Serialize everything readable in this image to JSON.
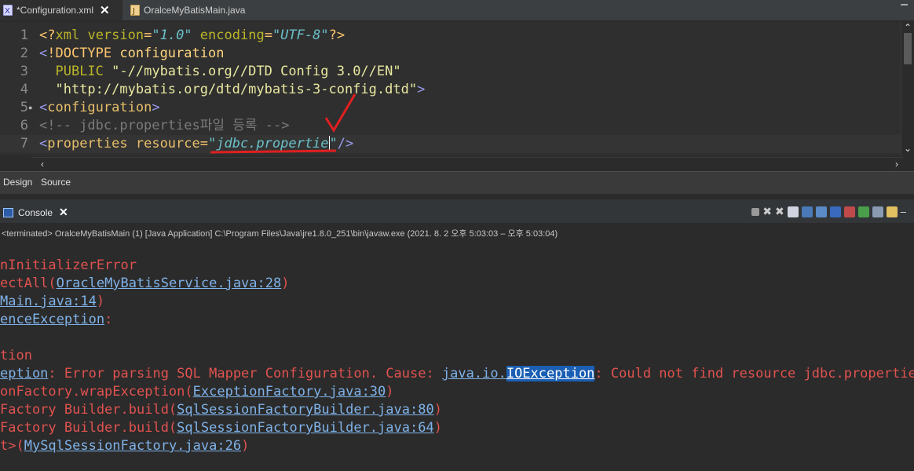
{
  "editor_tabs": [
    {
      "label": "*Configuration.xml",
      "icon": "xml-file-icon",
      "active": true
    },
    {
      "label": "OralceMyBatisMain.java",
      "icon": "java-file-icon",
      "active": false
    }
  ],
  "editor": {
    "lines": [
      {
        "n": "1",
        "text": "<?xml version=\"1.0\" encoding=\"UTF-8\"?>"
      },
      {
        "n": "2",
        "text": "<!DOCTYPE configuration"
      },
      {
        "n": "3",
        "text": "  PUBLIC \"-//mybatis.org//DTD Config 3.0//EN\""
      },
      {
        "n": "4",
        "text": "  \"http://mybatis.org/dtd/mybatis-3-config.dtd\">"
      },
      {
        "n": "5",
        "text": "<configuration>"
      },
      {
        "n": "6",
        "text": "<!-- jdbc.properties파일 등록 -->"
      },
      {
        "n": "7",
        "text": "<properties resource=\"jdbc.propertie\"/>"
      }
    ]
  },
  "bottom_tabs": {
    "design": "Design",
    "source": "Source"
  },
  "console": {
    "title": "Console",
    "terminated": "<terminated> OralceMyBatisMain (1) [Java Application] C:\\Program Files\\Java\\jre1.8.0_251\\bin\\javaw.exe  (2021. 8. 2 오후 5:03:03 – 오후 5:03:04)",
    "lines": [
      {
        "pre": "nInitializerError",
        "link": "",
        "post": ""
      },
      {
        "pre": "ectAll(",
        "link": "OracleMyBatisService.java:28",
        "post": ")"
      },
      {
        "pre": "",
        "link": "Main.java:14",
        "post": ")"
      },
      {
        "pre": "",
        "link": "enceException",
        "post": ":"
      },
      {
        "pre": "",
        "link": "",
        "post": ""
      },
      {
        "pre": "tion",
        "link": "",
        "post": ""
      },
      {
        "pre": "",
        "link": "eption",
        "post": ": Error parsing SQL Mapper Configuration. Cause: "
      },
      {
        "pre": "onFactory.wrapException(",
        "link": "ExceptionFactory.java:30",
        "post": ")"
      },
      {
        "pre": "Factory Builder.build(",
        "link": "SqlSessionFactoryBuilder.java:80",
        "post": ")"
      },
      {
        "pre": "Factory Builder.build(",
        "link": "SqlSessionFactoryBuilder.java:64",
        "post": ")"
      },
      {
        "pre": "t>(",
        "link": "MySqlSessionFactory.java:26",
        "post": ")"
      }
    ],
    "cause_pkg": "java.io.",
    "cause_class": "IOException",
    "cause_msg": ": Could not find resource jdbc.propertie"
  },
  "colors": {
    "annotation": "#e02020",
    "selection": "#1a5fb4"
  }
}
